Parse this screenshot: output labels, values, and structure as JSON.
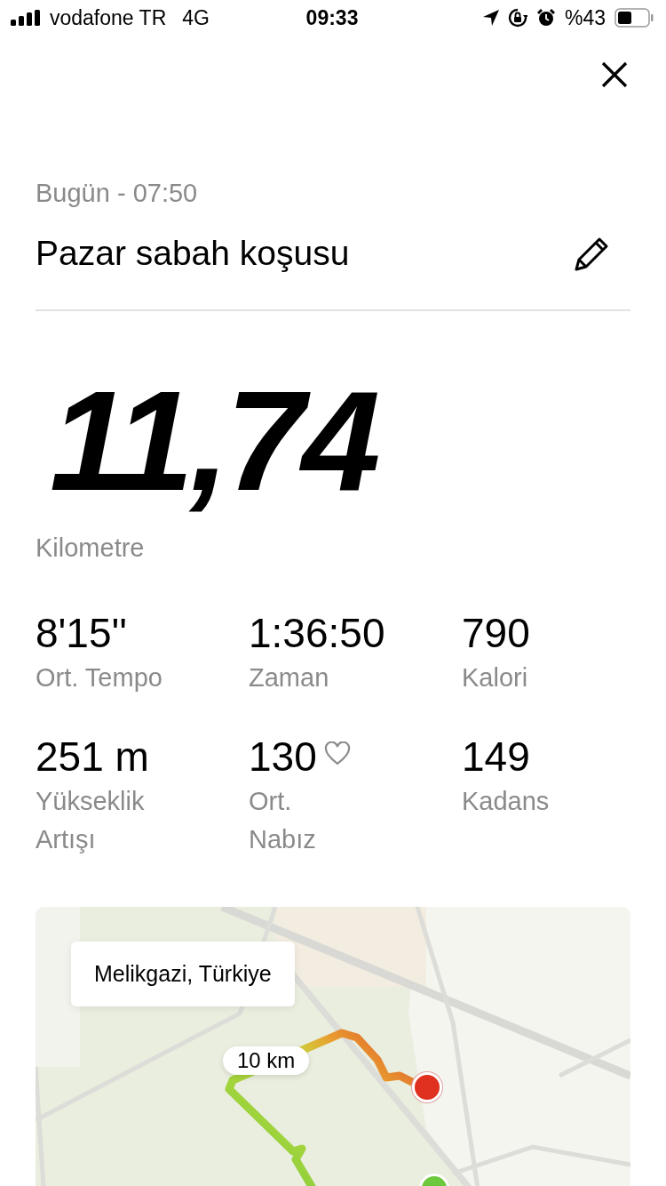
{
  "status_bar": {
    "carrier": "vodafone TR",
    "network": "4G",
    "time": "09:33",
    "battery": "%43"
  },
  "header": {
    "date": "Bugün - 07:50",
    "title": "Pazar sabah koşusu"
  },
  "distance": {
    "value": "11,74",
    "unit": "Kilometre"
  },
  "stats": [
    {
      "value": "8'15''",
      "label": "Ort. Tempo",
      "kind": "plain"
    },
    {
      "value": "1:36:50",
      "label": "Zaman",
      "kind": "plain"
    },
    {
      "value": "790",
      "label": "Kalori",
      "kind": "plain"
    },
    {
      "value": "251 m",
      "label": "Yükseklik\nArtışı",
      "kind": "plain"
    },
    {
      "value": "130",
      "label": "Ort.\nNabız",
      "kind": "heart"
    },
    {
      "value": "149",
      "label": "Kadans",
      "kind": "plain"
    }
  ],
  "map": {
    "kind": "picture",
    "location": "Melikgazi, Türkiye",
    "distance_marker": "10 km"
  }
}
